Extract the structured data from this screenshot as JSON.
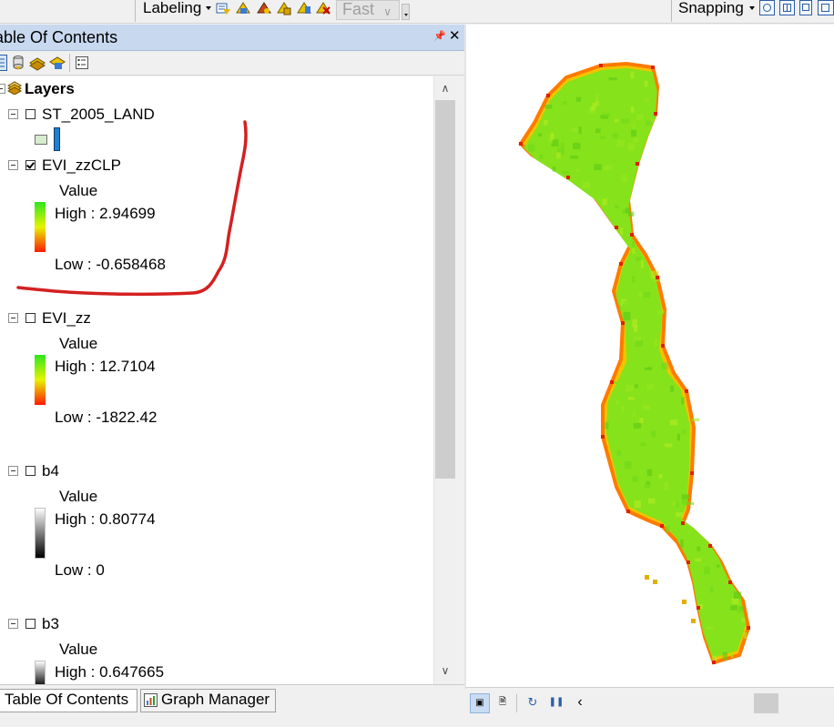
{
  "toolbar": {
    "labeling_label": "Labeling",
    "fast_value": "Fast",
    "snapping_label": "Snapping"
  },
  "toc": {
    "title": "Table Of Contents",
    "root_label": "Layers",
    "layers": [
      {
        "name": "ST_2005_LAND",
        "checked": false
      },
      {
        "name": "EVI_zzCLP",
        "checked": true,
        "field": "Value",
        "high": "High : 2.94699",
        "low": "Low : -0.658468"
      },
      {
        "name": "EVI_zz",
        "checked": false,
        "field": "Value",
        "high": "High : 12.7104",
        "low": "Low : -1822.42"
      },
      {
        "name": "b4",
        "checked": false,
        "field": "Value",
        "high": "High : 0.80774",
        "low": "Low : 0"
      },
      {
        "name": "b3",
        "checked": false,
        "field": "Value",
        "high": "High : 0.647665"
      }
    ]
  },
  "tabs": [
    {
      "label": "Table Of Contents",
      "active": true
    },
    {
      "label": "Graph Manager",
      "active": false
    }
  ],
  "colors": {
    "ramp_high": "#2ee51e",
    "ramp_mid": "#e6f400",
    "ramp_low": "#ff1a00",
    "annotation": "#d42020",
    "title_bar": "#c8d9ef"
  }
}
